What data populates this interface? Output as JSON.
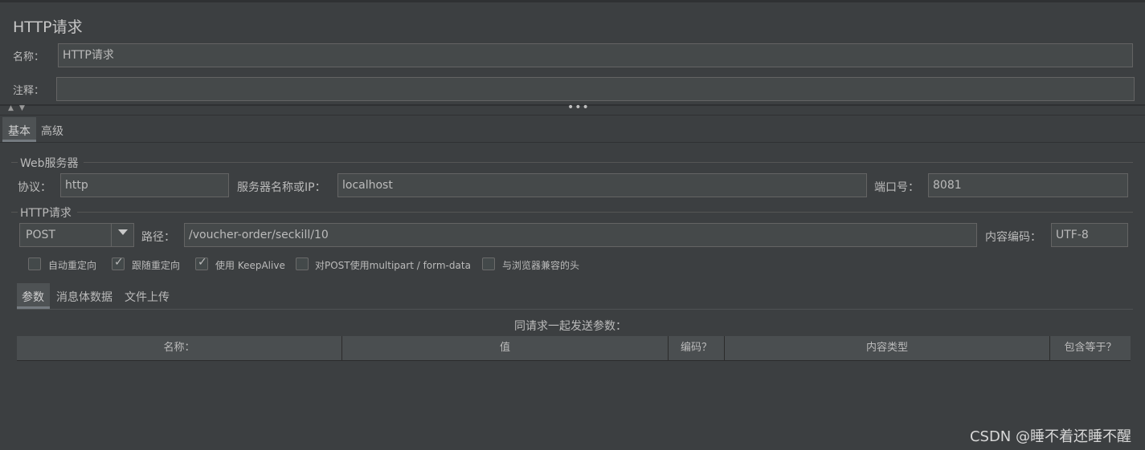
{
  "panel_title": "HTTP请求",
  "name_label": "名称：",
  "name_value": "HTTP请求",
  "comment_label": "注释：",
  "comment_value": "",
  "tabs": {
    "basic": "基本",
    "advanced": "高级"
  },
  "web_server": {
    "legend": "Web服务器",
    "protocol_label": "协议：",
    "protocol_value": "http",
    "server_label": "服务器名称或IP：",
    "server_value": "localhost",
    "port_label": "端口号：",
    "port_value": "8081"
  },
  "http_request": {
    "legend": "HTTP请求",
    "method_value": "POST",
    "path_label": "路径：",
    "path_value": "/voucher-order/seckill/10",
    "encoding_label": "内容编码：",
    "encoding_value": "UTF-8"
  },
  "options": [
    {
      "label": "自动重定向",
      "checked": false
    },
    {
      "label": "跟随重定向",
      "checked": true
    },
    {
      "label": "使用 KeepAlive",
      "checked": true
    },
    {
      "label": "对POST使用multipart / form-data",
      "checked": false
    },
    {
      "label": "与浏览器兼容的头",
      "checked": false
    }
  ],
  "subtabs": {
    "params": "参数",
    "body": "消息体数据",
    "files": "文件上传"
  },
  "params_caption": "同请求一起发送参数：",
  "table_headers": {
    "name": "名称：",
    "value": "值",
    "encode": "编码？",
    "content_type": "内容类型",
    "include_equals": "包含等于？"
  },
  "watermark": "CSDN @睡不着还睡不醒",
  "colors": {
    "background": "#3c3f41",
    "field": "#45494a",
    "border": "#646464",
    "text": "#bbbbbb",
    "header": "#4a4e50"
  }
}
